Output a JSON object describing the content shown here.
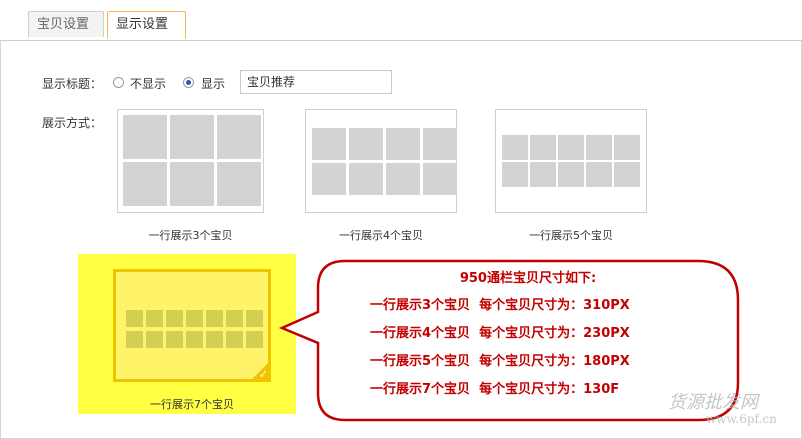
{
  "tabs": [
    {
      "label": "宝贝设置"
    },
    {
      "label": "显示设置"
    }
  ],
  "title_setting": {
    "label": "显示标题：",
    "option_hide": "不显示",
    "option_show": "显示",
    "selected": "显示",
    "input_value": "宝贝推荐"
  },
  "layout_setting": {
    "label": "展示方式：",
    "options": [
      {
        "caption": "一行展示3个宝贝",
        "columns": 3
      },
      {
        "caption": "一行展示4个宝贝",
        "columns": 4
      },
      {
        "caption": "一行展示5个宝贝",
        "columns": 5
      },
      {
        "caption": "一行展示7个宝贝",
        "columns": 7,
        "selected": true
      }
    ]
  },
  "callout": {
    "title": "950通栏宝贝尺寸如下:",
    "lines": [
      "一行展示3个宝贝  每个宝贝尺寸为：310PX",
      "一行展示4个宝贝  每个宝贝尺寸为：230PX",
      "一行展示5个宝贝  每个宝贝尺寸为：180PX",
      "一行展示7个宝贝  每个宝贝尺寸为：130F"
    ]
  },
  "watermark": {
    "text": "货源批发网",
    "url": "www.6pf.cn"
  },
  "colors": {
    "highlight": "#ffff44",
    "callout_text": "#c40000",
    "callout_border": "#c00000",
    "tab_active_border": "#f0b85a"
  }
}
